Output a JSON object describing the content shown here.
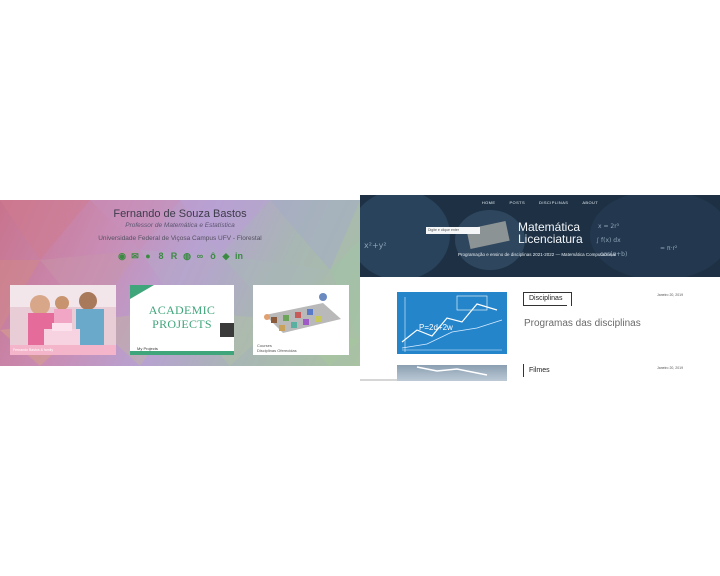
{
  "left_panel": {
    "name": "Fernando de Souza Bastos",
    "subtitle": "Professor de Matemática e Estatística",
    "university": "Universidade Federal de Viçosa Campus UFV - Florestal",
    "social_icons": [
      "mendeley-icon",
      "email-icon",
      "github-icon",
      "google-scholar-icon",
      "researchgate-icon",
      "orcid-icon",
      "lattes-icon",
      "academia-icon",
      "twitter-icon",
      "linkedin-icon"
    ],
    "cards": {
      "photo_caption": "Fernando Bastos & family",
      "projects_title_line1": "ACADEMIC",
      "projects_title_line2": "PROJECTS",
      "projects_caption": "My Projects",
      "courses_caption_line1": "Courses",
      "courses_caption_line2": "Disciplinas Oferecidas"
    },
    "colors": {
      "accent": "#3fa57a",
      "social": "#3a8a42"
    }
  },
  "right_panel": {
    "nav": [
      "HOME",
      "POSTS",
      "DISCIPLINAS",
      "ABOUT"
    ],
    "search_placeholder": "Digite e clique enter",
    "site_title_line1": "Matemática",
    "site_title_line2": "Licenciatura",
    "site_subtitle": "Programação e ensino de disciplinas 2021-2022 — Matemática Computacional",
    "posts": [
      {
        "tag": "Disciplinas",
        "title": "Programas das disciplinas",
        "date": "Janeiro 20, 2019"
      },
      {
        "tag": "Filmes",
        "date": "Janeiro 20, 2019"
      }
    ],
    "post_image_formula": "P=2d+2w",
    "colors": {
      "banner": "#1b2d3f",
      "title_text": "#f2f6fa"
    }
  }
}
